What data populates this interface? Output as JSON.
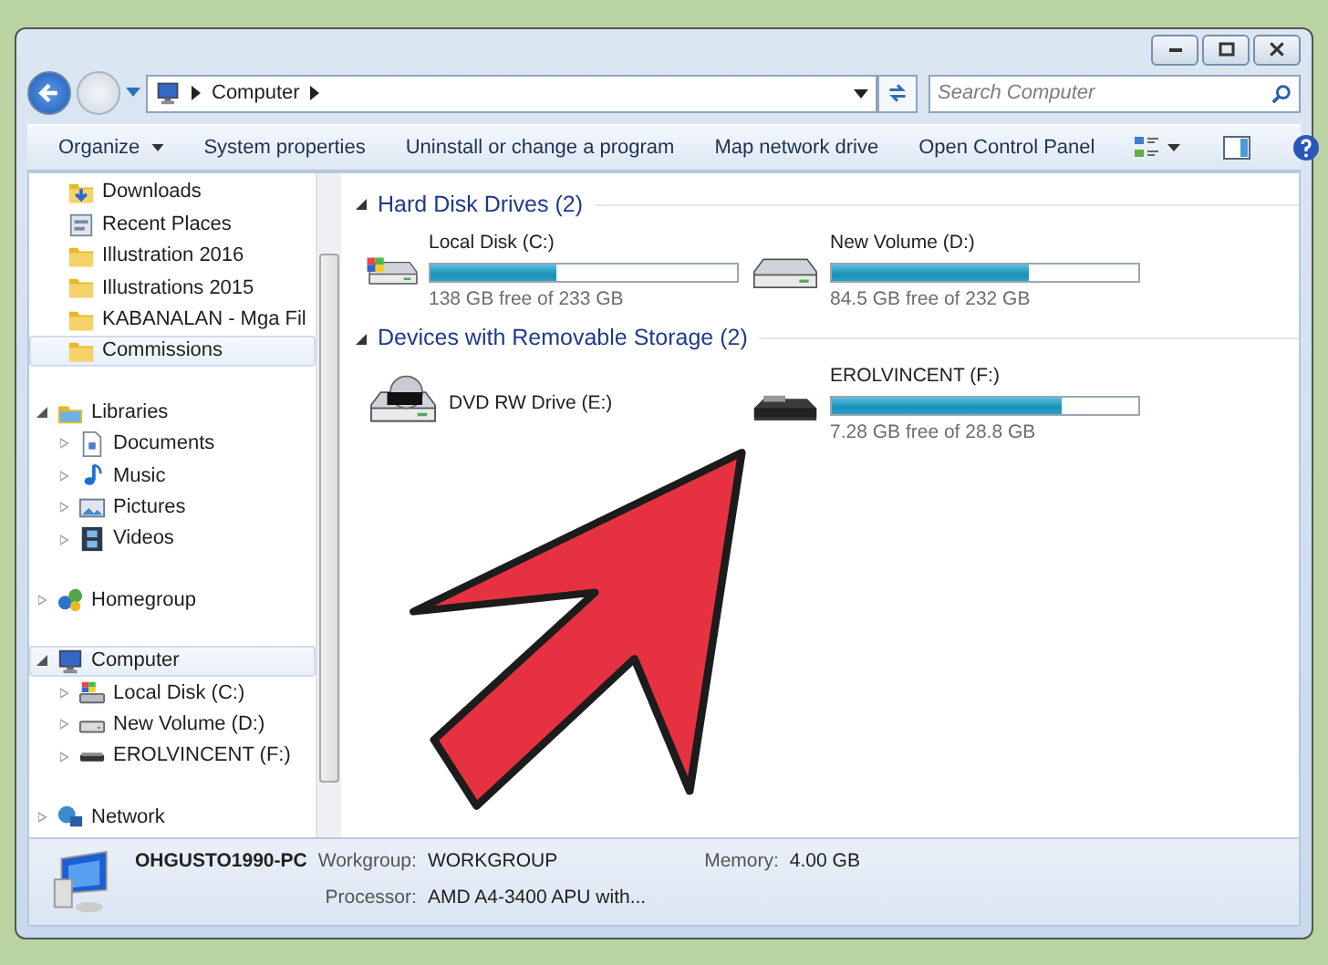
{
  "window": {
    "controls": [
      {
        "kind": "minimize"
      },
      {
        "kind": "maximize"
      },
      {
        "kind": "close"
      }
    ]
  },
  "address": {
    "path": "Computer",
    "search_placeholder": "Search Computer"
  },
  "toolbar": {
    "items": [
      {
        "label": "Organize",
        "kind": "dropdown"
      },
      {
        "label": "System properties",
        "kind": "plain"
      },
      {
        "label": "Uninstall or change a program",
        "kind": "plain"
      },
      {
        "label": "Map network drive",
        "kind": "plain"
      },
      {
        "label": "Open Control Panel",
        "kind": "plain"
      }
    ]
  },
  "nav": {
    "favorites": [
      {
        "label": "Downloads",
        "kind": "downloads",
        "selected": false
      },
      {
        "label": "Recent Places",
        "kind": "recent",
        "selected": false
      },
      {
        "label": "Illustration 2016",
        "kind": "folder",
        "selected": false
      },
      {
        "label": "Illustrations 2015",
        "kind": "folder",
        "selected": false
      },
      {
        "label": "KABANALAN - Mga Fil",
        "kind": "folder",
        "selected": false
      },
      {
        "label": "Commissions",
        "kind": "folder",
        "selected": true
      }
    ],
    "groups": [
      {
        "label": "Libraries",
        "kind": "library",
        "expanded": true,
        "selected": false,
        "children": [
          {
            "label": "Documents",
            "kind": "document",
            "selected": false
          },
          {
            "label": "Music",
            "kind": "music",
            "selected": false
          },
          {
            "label": "Pictures",
            "kind": "pictures",
            "selected": false
          },
          {
            "label": "Videos",
            "kind": "videos",
            "selected": false
          }
        ]
      },
      {
        "label": "Homegroup",
        "kind": "homegroup",
        "expanded": false,
        "selected": false
      },
      {
        "label": "Computer",
        "kind": "computer",
        "expanded": true,
        "selected": true,
        "children": [
          {
            "label": "Local Disk (C:)",
            "kind": "system-drive",
            "selected": false
          },
          {
            "label": "New Volume (D:)",
            "kind": "drive",
            "selected": false
          },
          {
            "label": "EROLVINCENT (F:)",
            "kind": "usb",
            "selected": false
          }
        ]
      },
      {
        "label": "Network",
        "kind": "network",
        "expanded": false,
        "selected": false
      }
    ]
  },
  "sections": [
    {
      "title": "Hard Disk Drives (2)",
      "drives": [
        {
          "name": "Local Disk (C:)",
          "kind": "system-drive",
          "level": 0.41,
          "free": "138 GB free of 233 GB"
        },
        {
          "name": "New Volume (D:)",
          "kind": "drive",
          "level": 0.64,
          "free": "84.5 GB free of 232 GB"
        }
      ]
    },
    {
      "title": "Devices with Removable Storage (2)",
      "drives": [
        {
          "name": "DVD RW Drive (E:)",
          "kind": "dvd"
        },
        {
          "name": "EROLVINCENT (F:)",
          "kind": "usb",
          "level": 0.75,
          "free": "7.28 GB free of 28.8 GB"
        }
      ]
    }
  ],
  "details": {
    "computer_name": "OHGUSTO1990-PC",
    "fields": [
      {
        "label": "Workgroup:",
        "value": "WORKGROUP"
      },
      {
        "label": "Memory:",
        "value": "4.00 GB"
      },
      {
        "label": "Processor:",
        "value": "AMD A4-3400 APU with..."
      }
    ]
  },
  "overlay": {
    "kind": "arrow"
  }
}
